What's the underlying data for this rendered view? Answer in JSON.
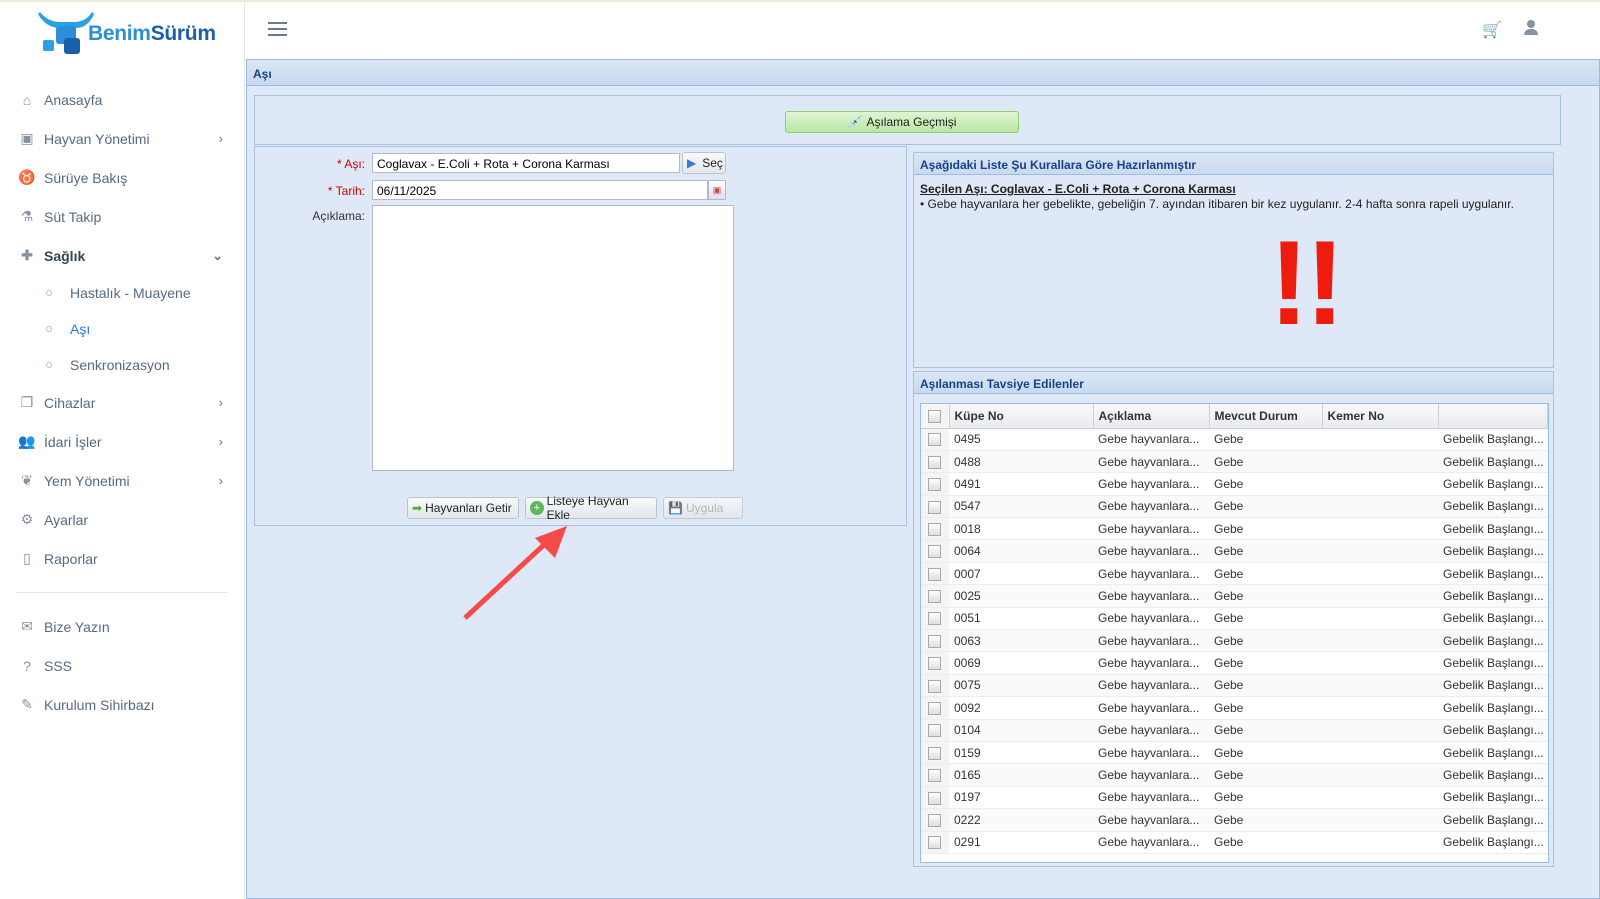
{
  "brand": {
    "name_a": "Benim",
    "name_b": "Sürüm",
    "accent": "#2a8fd8"
  },
  "sidebar": {
    "items": [
      {
        "label": "Anasayfa",
        "icon": "home-icon",
        "chevron": false
      },
      {
        "label": "Hayvan Yönetimi",
        "icon": "barn-icon",
        "chevron": true
      },
      {
        "label": "Sürüye Bakış",
        "icon": "cow-icon",
        "chevron": false
      },
      {
        "label": "Süt Takip",
        "icon": "flask-icon",
        "chevron": false
      },
      {
        "label": "Sağlık",
        "icon": "health-icon",
        "chevron": "down"
      }
    ],
    "sub_items": [
      {
        "label": "Hastalık - Muayene"
      },
      {
        "label": "Aşı",
        "active": true
      },
      {
        "label": "Senkronizasyon"
      }
    ],
    "items2": [
      {
        "label": "Cihazlar",
        "icon": "devices-icon"
      },
      {
        "label": "İdari İşler",
        "icon": "users-gear-icon"
      },
      {
        "label": "Yem Yönetimi",
        "icon": "feed-icon"
      },
      {
        "label": "Ayarlar",
        "icon": "gear-icon"
      },
      {
        "label": "Raporlar",
        "icon": "file-icon"
      }
    ],
    "items3": [
      {
        "label": "Bize Yazın",
        "icon": "contact-icon"
      },
      {
        "label": "SSS",
        "icon": "question-icon"
      },
      {
        "label": "Kurulum Sihirbazı",
        "icon": "wand-icon"
      }
    ]
  },
  "panel": {
    "title": "Aşı",
    "history_button": "Aşılama Geçmişi"
  },
  "form": {
    "asi_label": "Aşı:",
    "asi_value": "Coglavax - E.Coli + Rota + Corona Karması",
    "sec_button": "Seç",
    "tarih_label": "Tarih:",
    "tarih_value": "06/11/2025",
    "aciklama_label": "Açıklama:",
    "aciklama_value": "",
    "required_mark": "*",
    "buttons": {
      "get": "Hayvanları Getir",
      "add": "Listeye Hayvan Ekle",
      "apply": "Uygula"
    }
  },
  "rules": {
    "title": "Aşağıdaki Liste Şu Kurallara Göre Hazırlanmıştır",
    "selected": "Seçilen Aşı: Coglavax - E.Coli + Rota + Corona Karması",
    "rule": "• Gebe hayvanlara her gebelikte, gebeliğin 7. ayından itibaren bir kez uygulanır. 2-4 hafta sonra rapeli uygulanır.",
    "warning_glyph": "!!",
    "warning_color": "#ee1c0e"
  },
  "recommended": {
    "title": "Aşılanması Tavsiye Edilenler",
    "columns": [
      "Küpe No",
      "Açıklama",
      "Mevcut Durum",
      "Kemer No",
      ""
    ],
    "rows": [
      [
        "0495",
        "Gebe hayvanlara...",
        "Gebe",
        "",
        "Gebelik Başlangı..."
      ],
      [
        "0488",
        "Gebe hayvanlara...",
        "Gebe",
        "",
        "Gebelik Başlangı..."
      ],
      [
        "0491",
        "Gebe hayvanlara...",
        "Gebe",
        "",
        "Gebelik Başlangı..."
      ],
      [
        "0547",
        "Gebe hayvanlara...",
        "Gebe",
        "",
        "Gebelik Başlangı..."
      ],
      [
        "0018",
        "Gebe hayvanlara...",
        "Gebe",
        "",
        "Gebelik Başlangı..."
      ],
      [
        "0064",
        "Gebe hayvanlara...",
        "Gebe",
        "",
        "Gebelik Başlangı..."
      ],
      [
        "0007",
        "Gebe hayvanlara...",
        "Gebe",
        "",
        "Gebelik Başlangı..."
      ],
      [
        "0025",
        "Gebe hayvanlara...",
        "Gebe",
        "",
        "Gebelik Başlangı..."
      ],
      [
        "0051",
        "Gebe hayvanlara...",
        "Gebe",
        "",
        "Gebelik Başlangı..."
      ],
      [
        "0063",
        "Gebe hayvanlara...",
        "Gebe",
        "",
        "Gebelik Başlangı..."
      ],
      [
        "0069",
        "Gebe hayvanlara...",
        "Gebe",
        "",
        "Gebelik Başlangı..."
      ],
      [
        "0075",
        "Gebe hayvanlara...",
        "Gebe",
        "",
        "Gebelik Başlangı..."
      ],
      [
        "0092",
        "Gebe hayvanlara...",
        "Gebe",
        "",
        "Gebelik Başlangı..."
      ],
      [
        "0104",
        "Gebe hayvanlara...",
        "Gebe",
        "",
        "Gebelik Başlangı..."
      ],
      [
        "0159",
        "Gebe hayvanlara...",
        "Gebe",
        "",
        "Gebelik Başlangı..."
      ],
      [
        "0165",
        "Gebe hayvanlara...",
        "Gebe",
        "",
        "Gebelik Başlangı..."
      ],
      [
        "0197",
        "Gebe hayvanlara...",
        "Gebe",
        "",
        "Gebelik Başlangı..."
      ],
      [
        "0222",
        "Gebe hayvanlara...",
        "Gebe",
        "",
        "Gebelik Başlangı..."
      ],
      [
        "0291",
        "Gebe hayvanlara...",
        "Gebe",
        "",
        "Gebelik Başlangı..."
      ]
    ]
  },
  "annotation": {
    "color": "#f44a4a"
  }
}
